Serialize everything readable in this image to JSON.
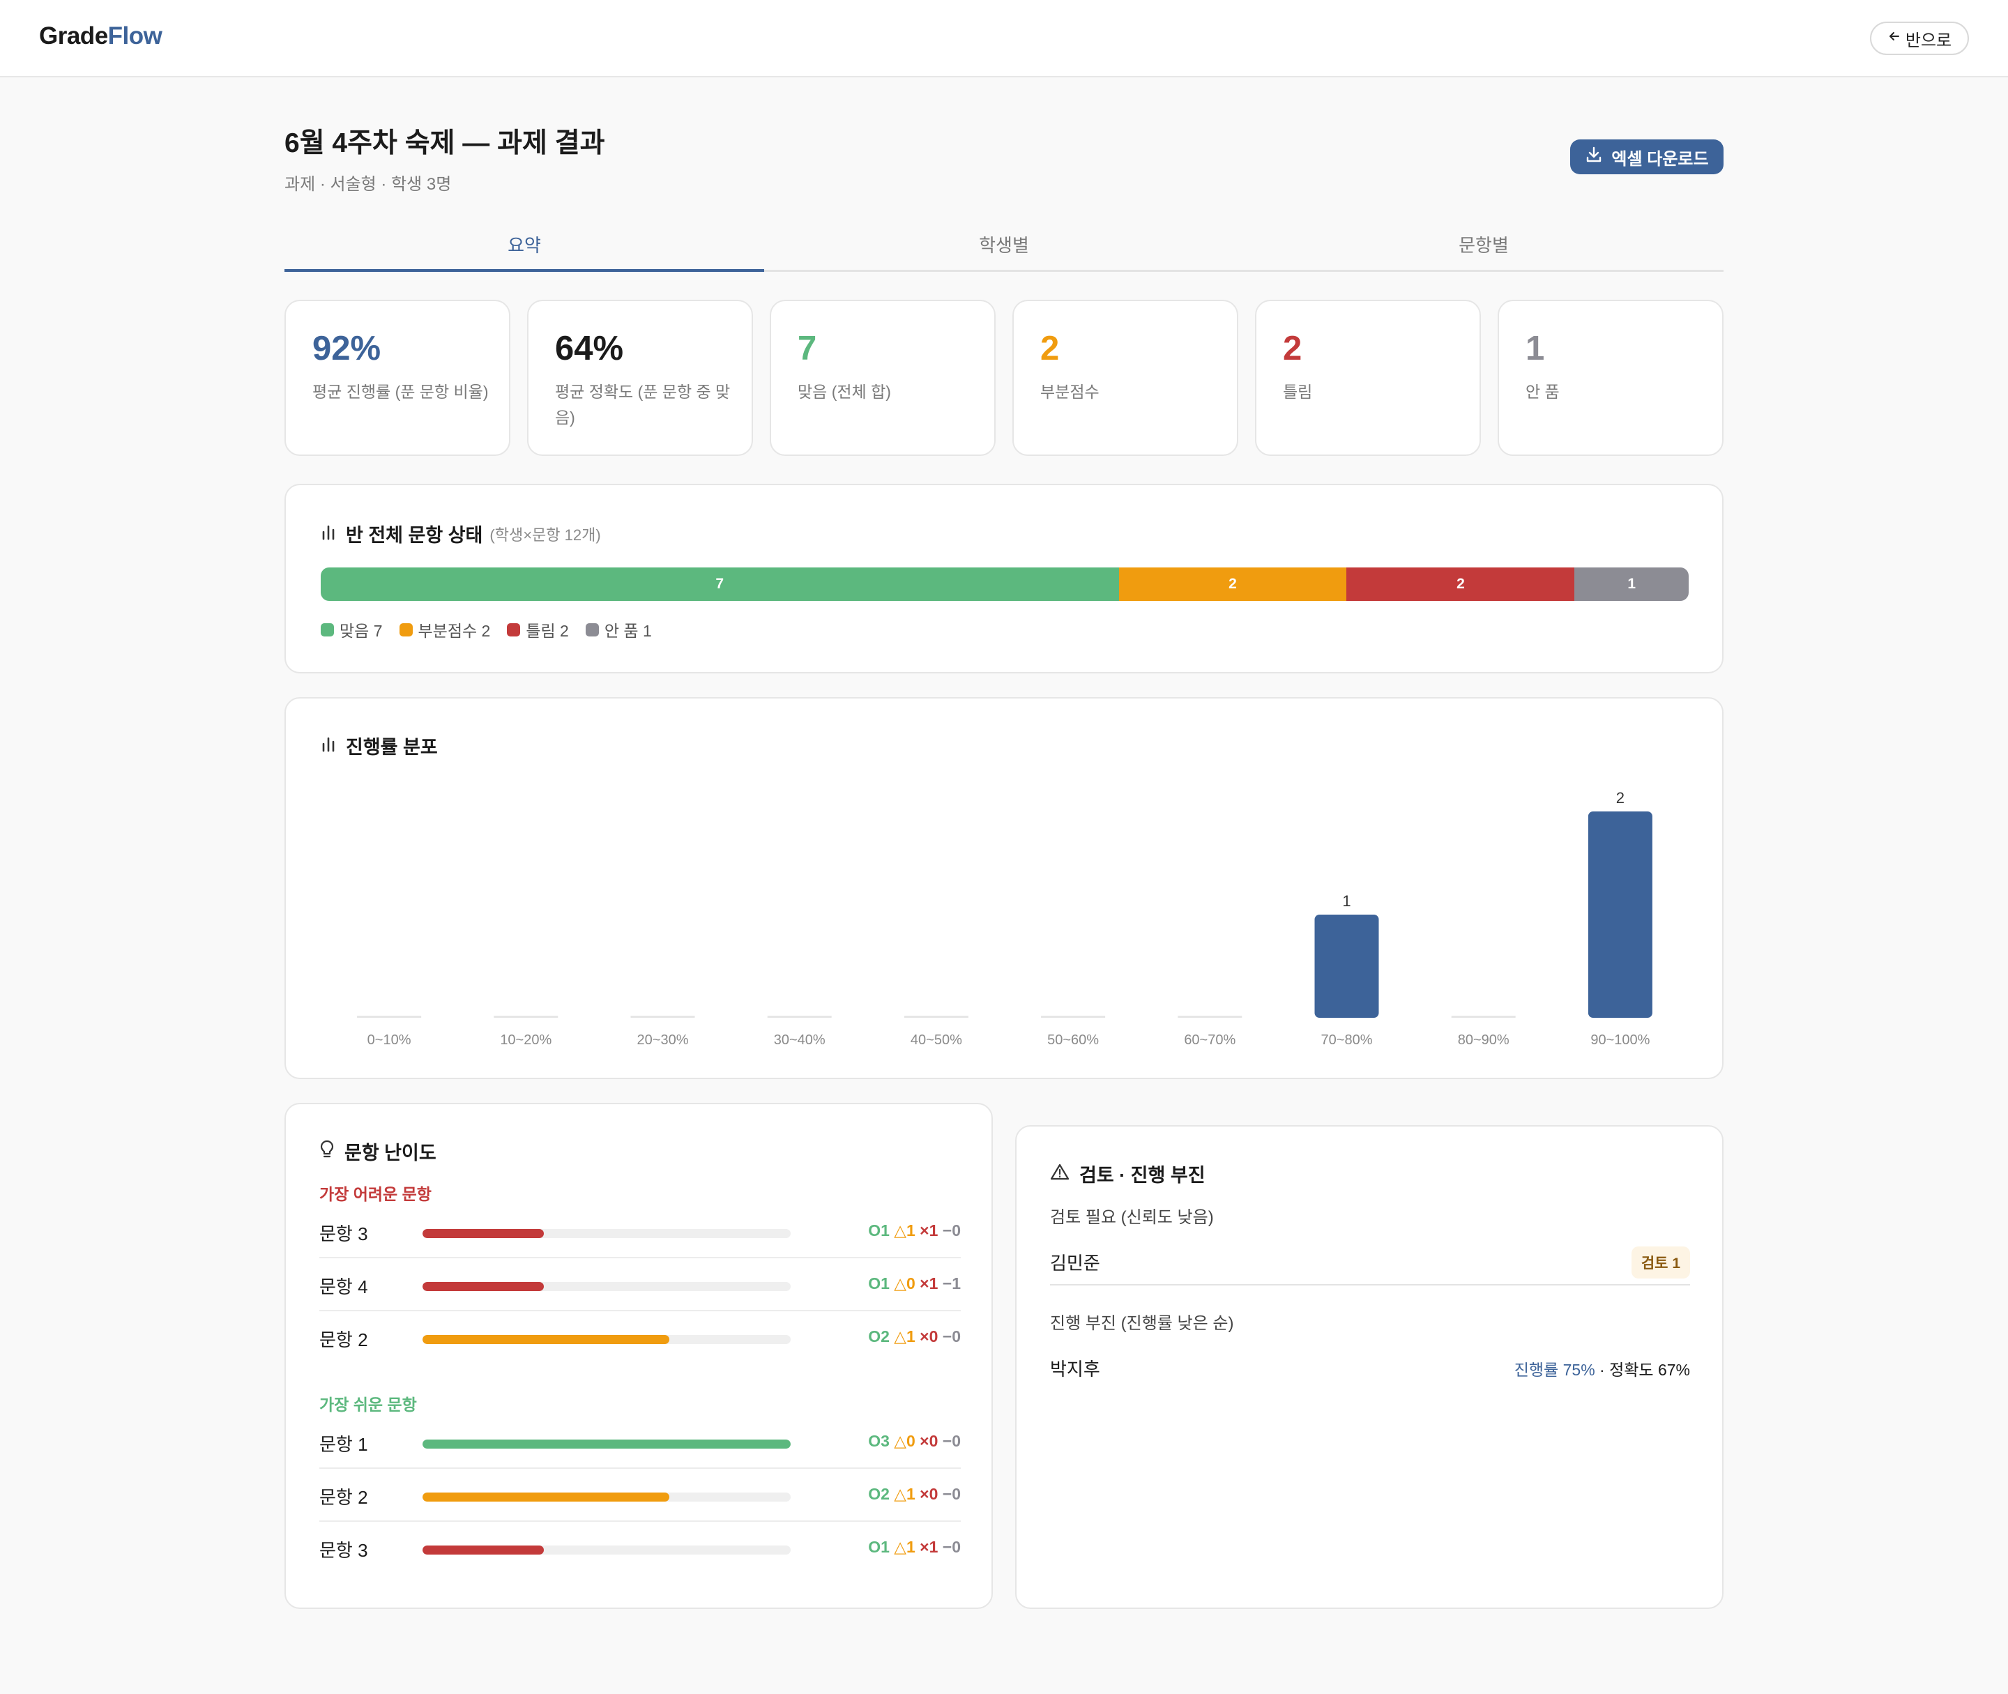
{
  "app": {
    "brand_main": "Grade",
    "brand_accent": "Flow",
    "back_label": "반으로"
  },
  "header": {
    "title": "6월 4주차 숙제 — 과제 결과",
    "subtitle": "과제 · 서술형 · 학생 3명",
    "download_label": "엑셀 다운로드"
  },
  "tabs": [
    {
      "label": "요약",
      "active": true
    },
    {
      "label": "학생별",
      "active": false
    },
    {
      "label": "문항별",
      "active": false
    }
  ],
  "stats": [
    {
      "value": "92%",
      "label": "평균 진행률 (푼 문항 비율)",
      "color": "#3d6399"
    },
    {
      "value": "64%",
      "label": "평균 정확도 (푼 문항 중 맞음)",
      "color": "#1b1b1b"
    },
    {
      "value": "7",
      "label": "맞음 (전체 합)",
      "color": "#5cb87e"
    },
    {
      "value": "2",
      "label": "부분점수",
      "color": "#f09c0f"
    },
    {
      "value": "2",
      "label": "틀림",
      "color": "#c33a3a"
    },
    {
      "value": "1",
      "label": "안 품",
      "color": "#8c8c94"
    }
  ],
  "status_overview": {
    "title": "반 전체 문항 상태",
    "note": "(학생×문항 12개)",
    "segments": [
      {
        "label": "맞음",
        "count": 7,
        "color": "#5cb87e"
      },
      {
        "label": "부분점수",
        "count": 2,
        "color": "#f09c0f"
      },
      {
        "label": "틀림",
        "count": 2,
        "color": "#c33a3a"
      },
      {
        "label": "안 품",
        "count": 1,
        "color": "#8c8c94"
      }
    ],
    "legend": [
      "맞음 7",
      "부분점수 2",
      "틀림 2",
      "안 품 1"
    ]
  },
  "progress_distribution": {
    "title": "진행률 분포"
  },
  "chart_data": {
    "type": "bar",
    "title": "진행률 분포",
    "categories": [
      "0~10%",
      "10~20%",
      "20~30%",
      "30~40%",
      "40~50%",
      "50~60%",
      "60~70%",
      "70~80%",
      "80~90%",
      "90~100%"
    ],
    "values": [
      0,
      0,
      0,
      0,
      0,
      0,
      0,
      1,
      0,
      2
    ],
    "ylim": [
      0,
      2
    ],
    "grid": false,
    "bar_color": "#3d6399"
  },
  "difficulty": {
    "title": "문항 난이도",
    "hardest_label": "가장 어려운 문항",
    "easiest_label": "가장 쉬운 문항",
    "hardest": [
      {
        "name": "문항 3",
        "correct_fraction": 0.33,
        "color": "#c33a3a",
        "ok": "O1",
        "part": "△1",
        "wrong": "×1",
        "none": "−0"
      },
      {
        "name": "문항 4",
        "correct_fraction": 0.33,
        "color": "#c33a3a",
        "ok": "O1",
        "part": "△0",
        "wrong": "×1",
        "none": "−1"
      },
      {
        "name": "문항 2",
        "correct_fraction": 0.67,
        "color": "#f09c0f",
        "ok": "O2",
        "part": "△1",
        "wrong": "×0",
        "none": "−0"
      }
    ],
    "easiest": [
      {
        "name": "문항 1",
        "correct_fraction": 1.0,
        "color": "#5cb87e",
        "ok": "O3",
        "part": "△0",
        "wrong": "×0",
        "none": "−0"
      },
      {
        "name": "문항 2",
        "correct_fraction": 0.67,
        "color": "#f09c0f",
        "ok": "O2",
        "part": "△1",
        "wrong": "×0",
        "none": "−0"
      },
      {
        "name": "문항 3",
        "correct_fraction": 0.33,
        "color": "#c33a3a",
        "ok": "O1",
        "part": "△1",
        "wrong": "×1",
        "none": "−0"
      }
    ]
  },
  "review": {
    "title": "검토 · 진행 부진",
    "needs_review_label": "검토 필요 (신뢰도 낮음)",
    "needs_review": [
      {
        "name": "김민준",
        "badge": "검토 1"
      }
    ],
    "slow_label": "진행 부진 (진행률 낮은 순)",
    "slow": [
      {
        "name": "박지후",
        "progress": "진행률 75%",
        "sep": " · ",
        "accuracy": "정확도 67%"
      }
    ]
  }
}
